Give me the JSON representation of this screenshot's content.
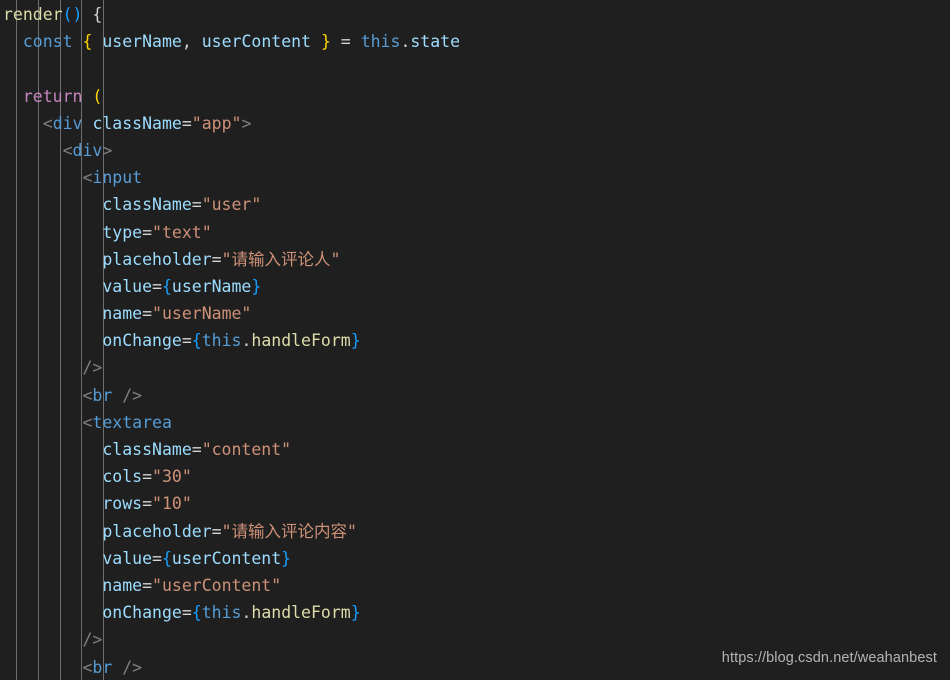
{
  "editor": {
    "language": "jsx",
    "theme": "Dark+",
    "background_color": "#1f1f1f",
    "indent_guide_color": "#6e6e6e",
    "font_size_px": 16.5,
    "line_height_px": 27.2,
    "indent_guide_x": [
      16,
      38,
      60,
      81,
      103
    ],
    "colors": {
      "plain": "#d4d4d4",
      "keyword": "#569cd6",
      "control": "#c586c0",
      "function": "#dcdcaa",
      "variable": "#9cdcfe",
      "attribute": "#9cdcfe",
      "string": "#ce9178",
      "tag": "#569cd6",
      "punctuation": "#808080",
      "bracket_yellow": "#ffd700",
      "bracket_purple": "#da70d6",
      "bracket_blue": "#179fff"
    },
    "lines": [
      {
        "n": 1,
        "indent": 0,
        "tokens": [
          {
            "t": "render",
            "c": "t-func"
          },
          {
            "t": "(",
            "c": "t-paren-b"
          },
          {
            "t": ")",
            "c": "t-paren-b"
          },
          {
            "t": " ",
            "c": "t-plain"
          },
          {
            "t": "{",
            "c": "t-brace"
          }
        ]
      },
      {
        "n": 2,
        "indent": 2,
        "tokens": [
          {
            "t": "const",
            "c": "t-keyword"
          },
          {
            "t": " ",
            "c": "t-plain"
          },
          {
            "t": "{",
            "c": "t-paren-y"
          },
          {
            "t": " ",
            "c": "t-plain"
          },
          {
            "t": "userName",
            "c": "t-var"
          },
          {
            "t": ",",
            "c": "t-plain"
          },
          {
            "t": " ",
            "c": "t-plain"
          },
          {
            "t": "userContent",
            "c": "t-var"
          },
          {
            "t": " ",
            "c": "t-plain"
          },
          {
            "t": "}",
            "c": "t-paren-y"
          },
          {
            "t": " = ",
            "c": "t-op"
          },
          {
            "t": "this",
            "c": "t-keyword"
          },
          {
            "t": ".",
            "c": "t-plain"
          },
          {
            "t": "state",
            "c": "t-var"
          }
        ]
      },
      {
        "n": 3,
        "indent": 0,
        "tokens": []
      },
      {
        "n": 4,
        "indent": 2,
        "tokens": [
          {
            "t": "return",
            "c": "t-control"
          },
          {
            "t": " ",
            "c": "t-plain"
          },
          {
            "t": "(",
            "c": "t-paren-y"
          }
        ]
      },
      {
        "n": 5,
        "indent": 4,
        "tokens": [
          {
            "t": "<",
            "c": "t-punct"
          },
          {
            "t": "div",
            "c": "t-tag"
          },
          {
            "t": " ",
            "c": "t-plain"
          },
          {
            "t": "className",
            "c": "t-attr"
          },
          {
            "t": "=",
            "c": "t-plain"
          },
          {
            "t": "\"app\"",
            "c": "t-string"
          },
          {
            "t": ">",
            "c": "t-punct"
          }
        ]
      },
      {
        "n": 6,
        "indent": 6,
        "tokens": [
          {
            "t": "<",
            "c": "t-punct"
          },
          {
            "t": "div",
            "c": "t-tag"
          },
          {
            "t": ">",
            "c": "t-punct"
          }
        ]
      },
      {
        "n": 7,
        "indent": 8,
        "tokens": [
          {
            "t": "<",
            "c": "t-punct"
          },
          {
            "t": "input",
            "c": "t-tag"
          }
        ]
      },
      {
        "n": 8,
        "indent": 10,
        "tokens": [
          {
            "t": "className",
            "c": "t-attr"
          },
          {
            "t": "=",
            "c": "t-plain"
          },
          {
            "t": "\"user\"",
            "c": "t-string"
          }
        ]
      },
      {
        "n": 9,
        "indent": 10,
        "tokens": [
          {
            "t": "type",
            "c": "t-attr"
          },
          {
            "t": "=",
            "c": "t-plain"
          },
          {
            "t": "\"text\"",
            "c": "t-string"
          }
        ]
      },
      {
        "n": 10,
        "indent": 10,
        "tokens": [
          {
            "t": "placeholder",
            "c": "t-attr"
          },
          {
            "t": "=",
            "c": "t-plain"
          },
          {
            "t": "\"请输入评论人\"",
            "c": "t-string"
          }
        ]
      },
      {
        "n": 11,
        "indent": 10,
        "tokens": [
          {
            "t": "value",
            "c": "t-attr"
          },
          {
            "t": "=",
            "c": "t-plain"
          },
          {
            "t": "{",
            "c": "t-paren-b"
          },
          {
            "t": "userName",
            "c": "t-var"
          },
          {
            "t": "}",
            "c": "t-paren-b"
          }
        ]
      },
      {
        "n": 12,
        "indent": 10,
        "tokens": [
          {
            "t": "name",
            "c": "t-attr"
          },
          {
            "t": "=",
            "c": "t-plain"
          },
          {
            "t": "\"userName\"",
            "c": "t-string"
          }
        ]
      },
      {
        "n": 13,
        "indent": 10,
        "tokens": [
          {
            "t": "onChange",
            "c": "t-attr"
          },
          {
            "t": "=",
            "c": "t-plain"
          },
          {
            "t": "{",
            "c": "t-paren-b"
          },
          {
            "t": "this",
            "c": "t-keyword"
          },
          {
            "t": ".",
            "c": "t-plain"
          },
          {
            "t": "handleForm",
            "c": "t-func"
          },
          {
            "t": "}",
            "c": "t-paren-b"
          }
        ]
      },
      {
        "n": 14,
        "indent": 8,
        "tokens": [
          {
            "t": "/",
            "c": "t-punct"
          },
          {
            "t": ">",
            "c": "t-punct"
          }
        ]
      },
      {
        "n": 15,
        "indent": 8,
        "tokens": [
          {
            "t": "<",
            "c": "t-punct"
          },
          {
            "t": "br",
            "c": "t-tag"
          },
          {
            "t": " ",
            "c": "t-plain"
          },
          {
            "t": "/",
            "c": "t-punct"
          },
          {
            "t": ">",
            "c": "t-punct"
          }
        ]
      },
      {
        "n": 16,
        "indent": 8,
        "tokens": [
          {
            "t": "<",
            "c": "t-punct"
          },
          {
            "t": "textarea",
            "c": "t-tag"
          }
        ]
      },
      {
        "n": 17,
        "indent": 10,
        "tokens": [
          {
            "t": "className",
            "c": "t-attr"
          },
          {
            "t": "=",
            "c": "t-plain"
          },
          {
            "t": "\"content\"",
            "c": "t-string"
          }
        ]
      },
      {
        "n": 18,
        "indent": 10,
        "tokens": [
          {
            "t": "cols",
            "c": "t-attr"
          },
          {
            "t": "=",
            "c": "t-plain"
          },
          {
            "t": "\"30\"",
            "c": "t-string"
          }
        ]
      },
      {
        "n": 19,
        "indent": 10,
        "tokens": [
          {
            "t": "rows",
            "c": "t-attr"
          },
          {
            "t": "=",
            "c": "t-plain"
          },
          {
            "t": "\"10\"",
            "c": "t-string"
          }
        ]
      },
      {
        "n": 20,
        "indent": 10,
        "tokens": [
          {
            "t": "placeholder",
            "c": "t-attr"
          },
          {
            "t": "=",
            "c": "t-plain"
          },
          {
            "t": "\"请输入评论内容\"",
            "c": "t-string"
          }
        ]
      },
      {
        "n": 21,
        "indent": 10,
        "tokens": [
          {
            "t": "value",
            "c": "t-attr"
          },
          {
            "t": "=",
            "c": "t-plain"
          },
          {
            "t": "{",
            "c": "t-paren-b"
          },
          {
            "t": "userContent",
            "c": "t-var"
          },
          {
            "t": "}",
            "c": "t-paren-b"
          }
        ]
      },
      {
        "n": 22,
        "indent": 10,
        "tokens": [
          {
            "t": "name",
            "c": "t-attr"
          },
          {
            "t": "=",
            "c": "t-plain"
          },
          {
            "t": "\"userContent\"",
            "c": "t-string"
          }
        ]
      },
      {
        "n": 23,
        "indent": 10,
        "tokens": [
          {
            "t": "onChange",
            "c": "t-attr"
          },
          {
            "t": "=",
            "c": "t-plain"
          },
          {
            "t": "{",
            "c": "t-paren-b"
          },
          {
            "t": "this",
            "c": "t-keyword"
          },
          {
            "t": ".",
            "c": "t-plain"
          },
          {
            "t": "handleForm",
            "c": "t-func"
          },
          {
            "t": "}",
            "c": "t-paren-b"
          }
        ]
      },
      {
        "n": 24,
        "indent": 8,
        "tokens": [
          {
            "t": "/",
            "c": "t-punct"
          },
          {
            "t": ">",
            "c": "t-punct"
          }
        ]
      },
      {
        "n": 25,
        "indent": 8,
        "tokens": [
          {
            "t": "<",
            "c": "t-punct"
          },
          {
            "t": "br",
            "c": "t-tag"
          },
          {
            "t": " ",
            "c": "t-plain"
          },
          {
            "t": "/",
            "c": "t-punct"
          },
          {
            "t": ">",
            "c": "t-punct"
          }
        ]
      }
    ]
  },
  "watermark": {
    "text": "https://blog.csdn.net/weahanbest"
  }
}
